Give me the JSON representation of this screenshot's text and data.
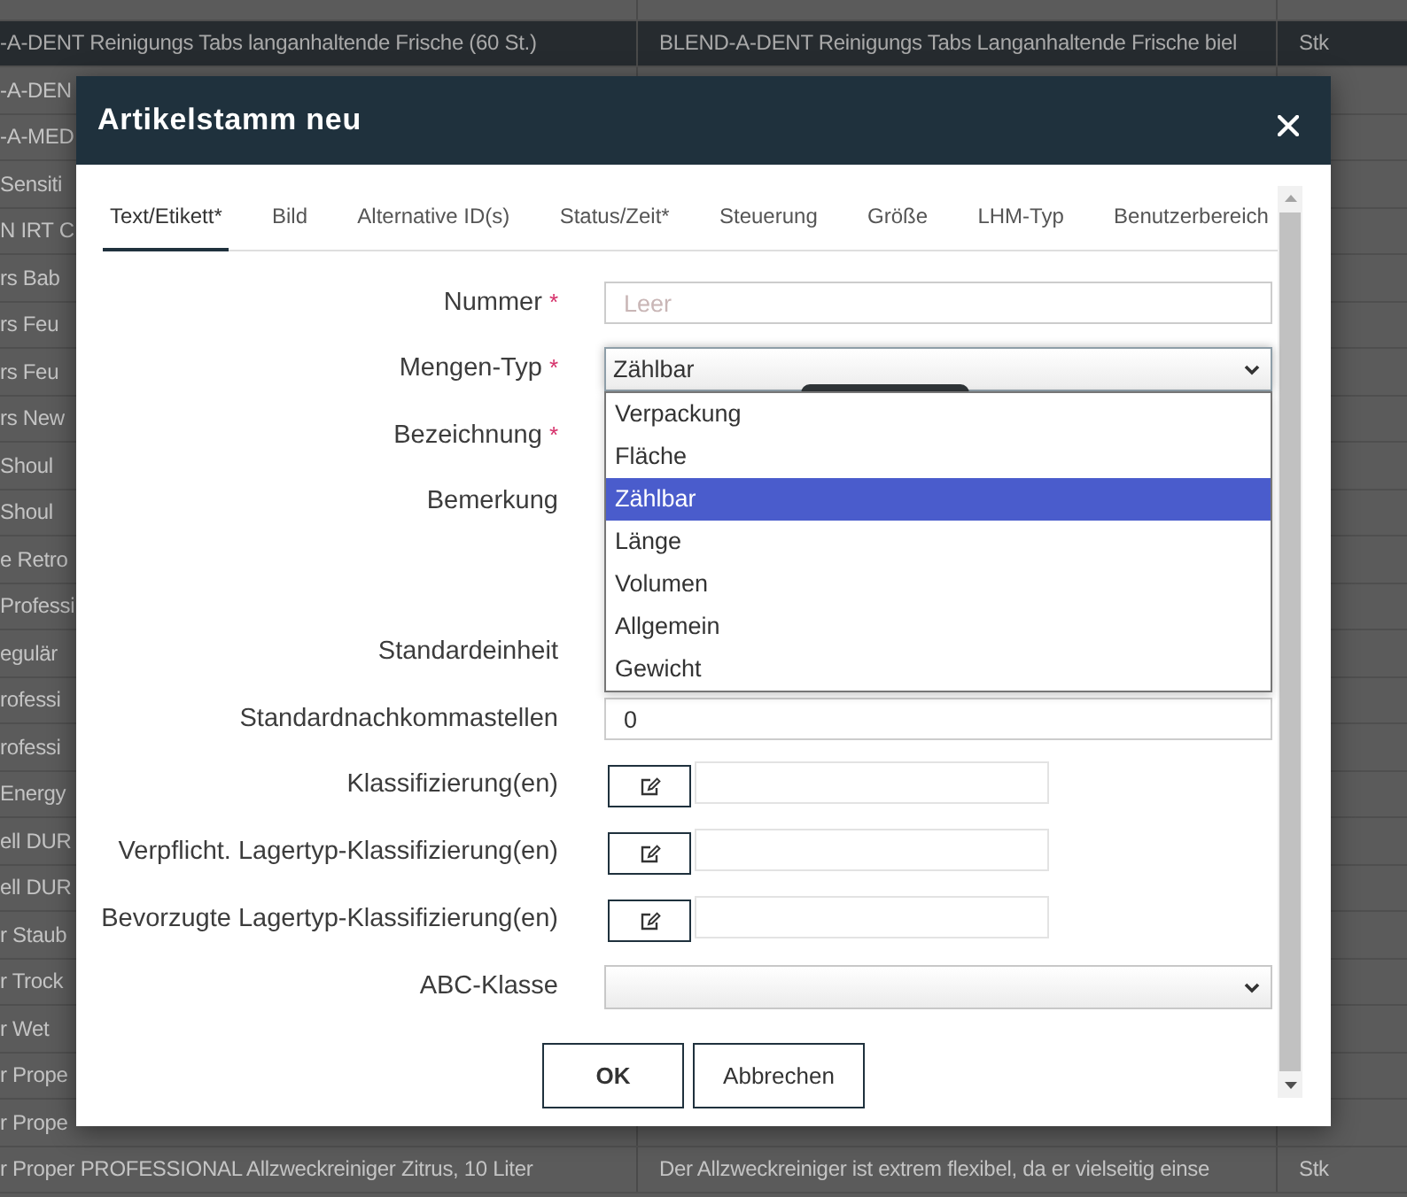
{
  "background_table": {
    "rows": [
      {
        "selected": true,
        "column_1": "-A-DENT Reinigungs Tabs langanhaltende Frische (60 St.)",
        "column_2": "BLEND-A-DENT Reinigungs Tabs Langanhaltende Frische biel",
        "column_3": "Stk"
      },
      {
        "selected": false,
        "column_1": "-A-DEN"
      },
      {
        "selected": false,
        "column_1": "-A-MED"
      },
      {
        "selected": false,
        "column_1": "Sensiti"
      },
      {
        "selected": false,
        "column_1": "N IRT C"
      },
      {
        "selected": false,
        "column_1": "rs Bab"
      },
      {
        "selected": false,
        "column_1": "rs Feu"
      },
      {
        "selected": false,
        "column_1": "rs Feu"
      },
      {
        "selected": false,
        "column_1": "rs New"
      },
      {
        "selected": false,
        "column_1": "Shoul"
      },
      {
        "selected": false,
        "column_1": "Shoul"
      },
      {
        "selected": false,
        "column_1": "e Retro"
      },
      {
        "selected": false,
        "column_1": "Professi"
      },
      {
        "selected": false,
        "column_1": "egulär"
      },
      {
        "selected": false,
        "column_1": "rofessi"
      },
      {
        "selected": false,
        "column_1": "rofessi"
      },
      {
        "selected": false,
        "column_1": "Energy"
      },
      {
        "selected": false,
        "column_1": "ell DUR"
      },
      {
        "selected": false,
        "column_1": "ell DUR"
      },
      {
        "selected": false,
        "column_1": "r Staub"
      },
      {
        "selected": false,
        "column_1": "r Trock"
      },
      {
        "selected": false,
        "column_1": "r Wet"
      },
      {
        "selected": false,
        "column_1": "r Prope"
      },
      {
        "selected": false,
        "column_1": "r Prope"
      },
      {
        "selected": false,
        "column_1": "r Proper PROFESSIONAL Allzweckreiniger Zitrus, 10 Liter",
        "column_2": "Der Allzweckreiniger ist extrem flexibel, da er vielseitig einse",
        "column_3": "Stk"
      }
    ]
  },
  "dialog": {
    "title": "Artikelstamm neu",
    "tabs": [
      {
        "label": "Text/Etikett*",
        "selected": true
      },
      {
        "label": "Bild",
        "selected": false
      },
      {
        "label": "Alternative ID(s)",
        "selected": false
      },
      {
        "label": "Status/Zeit*",
        "selected": false
      },
      {
        "label": "Steuerung",
        "selected": false
      },
      {
        "label": "Größe",
        "selected": false
      },
      {
        "label": "LHM-Typ",
        "selected": false
      },
      {
        "label": "Benutzerbereich",
        "selected": false
      }
    ],
    "fields": [
      {
        "label": "Nummer",
        "required_mark": "*",
        "kind": "text",
        "placeholder": "Leer"
      },
      {
        "label": "Mengen-Typ",
        "required_mark": "*",
        "kind": "select",
        "value": "Zählbar",
        "expanded": true,
        "options": [
          {
            "label": "Verpackung",
            "selected": false
          },
          {
            "label": "Fläche",
            "selected": false
          },
          {
            "label": "Zählbar",
            "selected": true
          },
          {
            "label": "Länge",
            "selected": false
          },
          {
            "label": "Volumen",
            "selected": false
          },
          {
            "label": "Allgemein",
            "selected": false
          },
          {
            "label": "Gewicht",
            "selected": false
          }
        ]
      },
      {
        "label": "Bezeichnung",
        "required_mark": "*",
        "kind": "text"
      },
      {
        "label": "Bemerkung",
        "kind": "textarea"
      },
      {
        "label": "Standardeinheit",
        "kind": "select"
      },
      {
        "label": "Standardnachkommastellen",
        "kind": "text",
        "value": "0"
      },
      {
        "label": "Klassifizierung(en)",
        "kind": "picker"
      },
      {
        "label": "Verpflicht. Lagertyp-Klassifizierung(en)",
        "kind": "picker"
      },
      {
        "label": "Bevorzugte Lagertyp-Klassifizierung(en)",
        "kind": "picker"
      },
      {
        "label": "ABC-Klasse",
        "kind": "select",
        "expanded": false
      }
    ],
    "buttons": [
      {
        "label": "OK",
        "kind": "primary"
      },
      {
        "label": "Abbrechen",
        "kind": "secondary"
      }
    ]
  }
}
